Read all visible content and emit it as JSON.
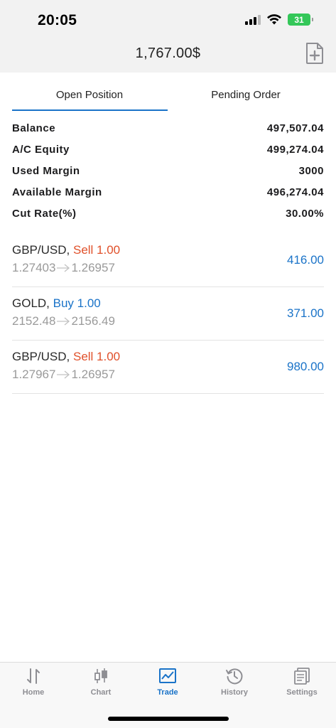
{
  "status": {
    "time": "20:05",
    "battery": "31"
  },
  "header": {
    "title": "1,767.00$"
  },
  "tabs": [
    {
      "label": "Open Position",
      "active": true
    },
    {
      "label": "Pending Order",
      "active": false
    }
  ],
  "summary": [
    {
      "label": "Balance",
      "value": "497,507.04"
    },
    {
      "label": "A/C Equity",
      "value": "499,274.04"
    },
    {
      "label": "Used Margin",
      "value": "3000"
    },
    {
      "label": "Available Margin",
      "value": "496,274.04"
    },
    {
      "label": "Cut Rate(%)",
      "value": "30.00%"
    }
  ],
  "positions": [
    {
      "symbol": "GBP/USD,",
      "side": "Sell 1.00",
      "side_type": "sell",
      "open": "1.27403",
      "current": "1.26957",
      "profit": "416.00"
    },
    {
      "symbol": "GOLD,",
      "side": "Buy 1.00",
      "side_type": "buy",
      "open": "2152.48",
      "current": "2156.49",
      "profit": "371.00"
    },
    {
      "symbol": "GBP/USD,",
      "side": "Sell 1.00",
      "side_type": "sell",
      "open": "1.27967",
      "current": "1.26957",
      "profit": "980.00"
    }
  ],
  "nav": [
    {
      "label": "Home",
      "icon": "sort-arrows-icon",
      "active": false
    },
    {
      "label": "Chart",
      "icon": "candlestick-icon",
      "active": false
    },
    {
      "label": "Trade",
      "icon": "trade-chart-icon",
      "active": true
    },
    {
      "label": "History",
      "icon": "history-icon",
      "active": false
    },
    {
      "label": "Settings",
      "icon": "settings-document-icon",
      "active": false
    }
  ],
  "colors": {
    "accent": "#1a73c8",
    "sell": "#e0502a",
    "muted": "#9a9a9a",
    "battery": "#34c759"
  }
}
